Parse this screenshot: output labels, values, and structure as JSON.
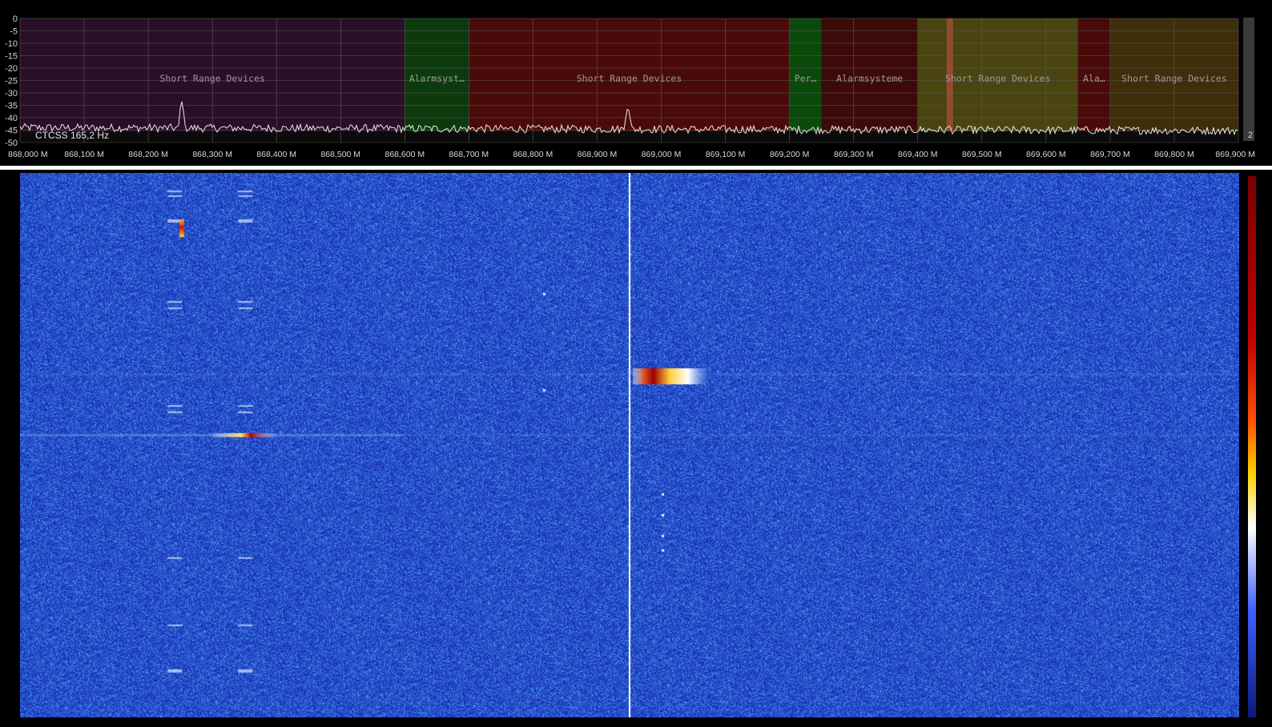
{
  "spectrum": {
    "y_ticks": [
      "0",
      "-5",
      "-10",
      "-15",
      "-20",
      "-25",
      "-30",
      "-35",
      "-40",
      "-45",
      "-50"
    ],
    "x_ticks": [
      "868,000 M",
      "868,100 M",
      "868,200 M",
      "868,300 M",
      "868,400 M",
      "868,500 M",
      "868,600 M",
      "868,700 M",
      "868,800 M",
      "868,900 M",
      "869,000 M",
      "869,100 M",
      "869,200 M",
      "869,300 M",
      "869,400 M",
      "869,500 M",
      "869,600 M",
      "869,700 M",
      "869,800 M",
      "869,900 M"
    ],
    "freq_range_mhz": [
      868.0,
      869.9
    ],
    "level_range_db": [
      -50,
      0
    ],
    "bands": [
      {
        "label": "Short Range Devices",
        "start": 868.0,
        "end": 868.6,
        "color": "#2a0f28"
      },
      {
        "label": "Alarmsyst…",
        "start": 868.6,
        "end": 868.7,
        "color": "#0c3a0c"
      },
      {
        "label": "Short Range Devices",
        "start": 868.7,
        "end": 869.2,
        "color": "#4a0a0a"
      },
      {
        "label": "Per…",
        "start": 869.2,
        "end": 869.25,
        "color": "#0c4a0c"
      },
      {
        "label": "Alarmsysteme",
        "start": 869.25,
        "end": 869.4,
        "color": "#3d0a0a"
      },
      {
        "label": "Short Range Devices",
        "start": 869.4,
        "end": 869.65,
        "color": "#4a4410"
      },
      {
        "label": "Ala…",
        "start": 869.65,
        "end": 869.7,
        "color": "#4a0a0a"
      },
      {
        "label": "Short Range Devices",
        "start": 869.7,
        "end": 869.9,
        "color": "#3e2e0a"
      }
    ],
    "peaks": [
      {
        "freq": 868.252,
        "level": -33
      },
      {
        "freq": 868.948,
        "level": -35
      },
      {
        "freq": 869.45,
        "level": -42
      }
    ],
    "ctcss_label": "CTCSS  165,2 Hz",
    "right_indicator": "2",
    "noise_floor_db": -44,
    "trace_color": "#e8e8e8"
  },
  "waterfall": {
    "tuned_freq": 868.95,
    "background_color": "#1b38c8"
  }
}
